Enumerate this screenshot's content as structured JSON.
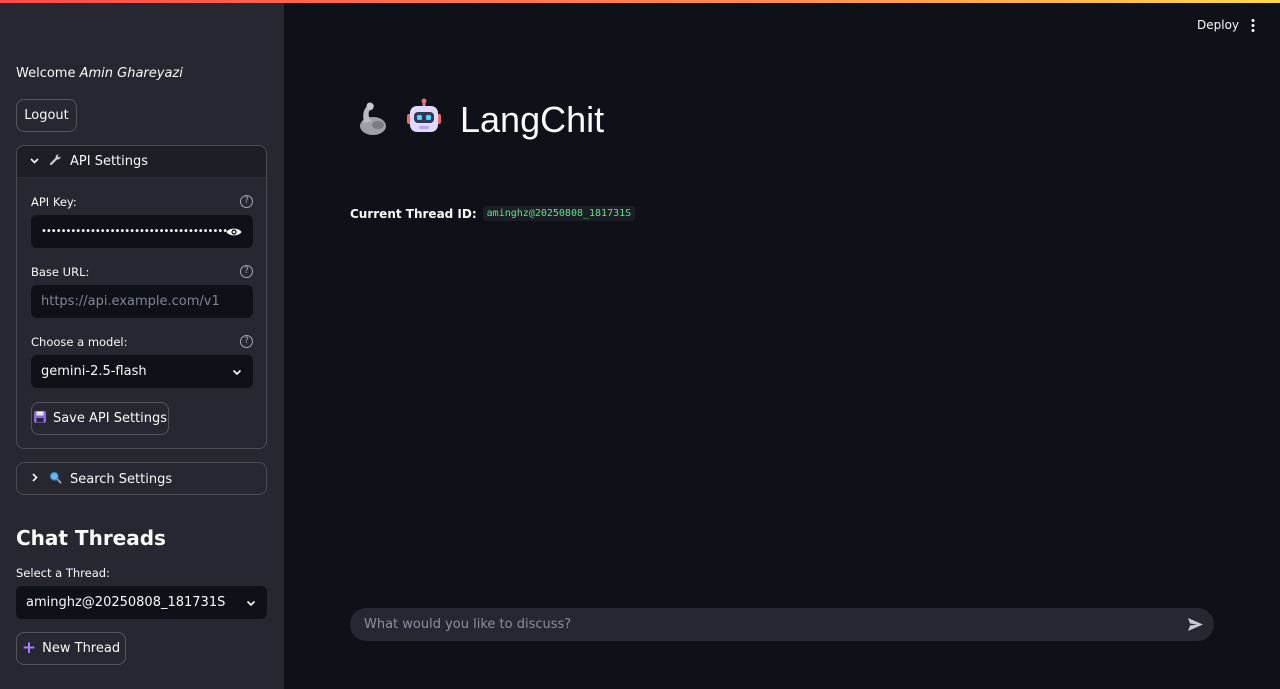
{
  "sidebar": {
    "welcome_prefix": "Welcome",
    "user_name": "Amin Ghareyazi",
    "logout_label": "Logout",
    "api_settings": {
      "title": "API Settings",
      "icon": "wrench-icon",
      "expanded": true,
      "api_key_label": "API Key:",
      "api_key_value": "••••••••••••••••••••••••••••••••••••••",
      "base_url_label": "Base URL:",
      "base_url_placeholder": "https://api.example.com/v1",
      "model_label": "Choose a model:",
      "model_value": "gemini-2.5-flash",
      "save_label": "Save API Settings",
      "save_icon": "floppy-disk-icon"
    },
    "search_settings": {
      "title": "Search Settings",
      "icon": "magnifier-icon",
      "expanded": false
    },
    "chat_threads": {
      "heading": "Chat Threads",
      "select_label": "Select a Thread:",
      "selected_thread": "aminghz@20250808_181731S",
      "new_thread_label": "New Thread"
    }
  },
  "header": {
    "deploy_label": "Deploy"
  },
  "main": {
    "title": "LangChit",
    "title_icons": [
      "flexed-biceps-icon",
      "robot-icon"
    ],
    "thread_id_label": "Current Thread ID:",
    "thread_id_value": "aminghz@20250808_181731S",
    "chat_placeholder": "What would you like to discuss?"
  },
  "colors": {
    "sidebar_bg": "#262730",
    "main_bg": "#0e1117",
    "accent_code": "#5ce488",
    "plus_accent": "#a77dff"
  }
}
